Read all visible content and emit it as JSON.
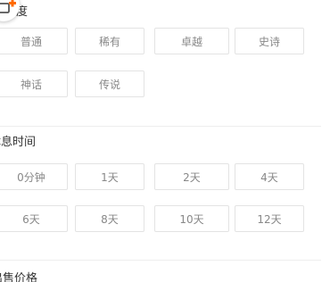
{
  "rarity": {
    "title": "稀有度",
    "options": [
      "普通",
      "稀有",
      "卓越",
      "史诗",
      "神话",
      "传说"
    ]
  },
  "rest": {
    "title": "休息时间",
    "options": [
      "0分钟",
      "1天",
      "2天",
      "4天",
      "6天",
      "8天",
      "10天",
      "12天"
    ]
  },
  "price": {
    "title": "出售价格"
  },
  "colors": {
    "border": "#e3e3e3",
    "text": "#888888",
    "title": "#333333",
    "badge_accent": "#ff6a00"
  },
  "icons": {
    "badge": "add-card-icon"
  }
}
